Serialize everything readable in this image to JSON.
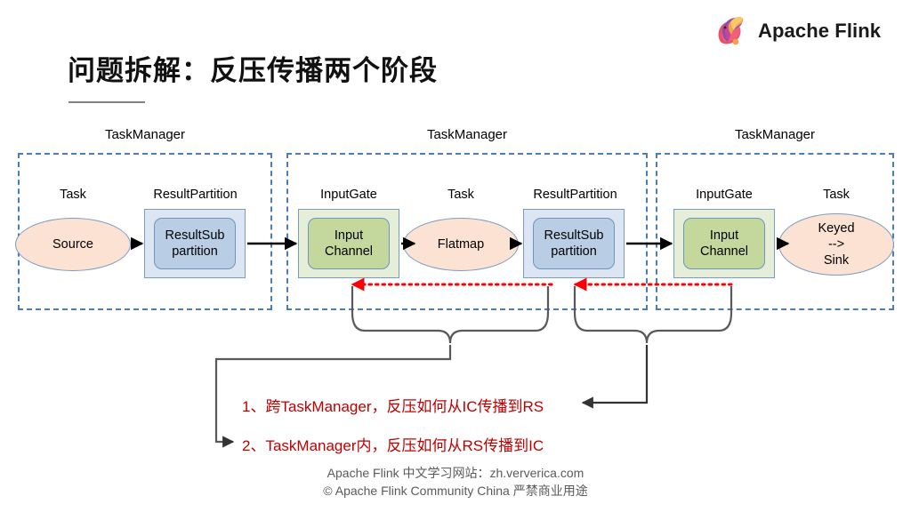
{
  "brand": {
    "name": "Apache Flink",
    "logo_icon": "flink-squirrel-icon"
  },
  "title": "问题拆解：反压传播两个阶段",
  "taskmanagers": [
    {
      "label": "TaskManager",
      "components": [
        {
          "caption": "Task",
          "shape": "ellipse",
          "lines": [
            "Source"
          ]
        },
        {
          "caption": "ResultPartition",
          "shape": "box",
          "color": "blue",
          "lines": [
            "ResultSub",
            "partition"
          ]
        }
      ]
    },
    {
      "label": "TaskManager",
      "components": [
        {
          "caption": "InputGate",
          "shape": "box",
          "color": "green",
          "lines": [
            "Input",
            "Channel"
          ]
        },
        {
          "caption": "Task",
          "shape": "ellipse",
          "lines": [
            "Flatmap"
          ]
        },
        {
          "caption": "ResultPartition",
          "shape": "box",
          "color": "blue",
          "lines": [
            "ResultSub",
            "partition"
          ]
        }
      ]
    },
    {
      "label": "TaskManager",
      "components": [
        {
          "caption": "InputGate",
          "shape": "box",
          "color": "green",
          "lines": [
            "Input",
            "Channel"
          ]
        },
        {
          "caption": "Task",
          "shape": "ellipse",
          "lines": [
            "Keyed",
            "-->",
            "Sink"
          ]
        }
      ]
    }
  ],
  "notes": [
    "1、跨TaskManager，反压如何从IC传播到RS",
    "2、TaskManager内，反压如何从RS传播到IC"
  ],
  "footer": [
    "Apache Flink 中文学习网站：zh.ververica.com",
    "© Apache Flink Community China 严禁商业用途"
  ],
  "colors": {
    "dashed_border": "#4a7ebb",
    "backpressure_arrow": "#ff0000",
    "note_text": "#c00000",
    "ellipse_fill": "#fbe2d2",
    "box_blue_outer": "#dce6f2",
    "box_blue_inner": "#b9cde4",
    "box_green_outer": "#e5eed8",
    "box_green_inner": "#c4d79c",
    "flow_arrow": "#000000",
    "brace": "#595959"
  }
}
